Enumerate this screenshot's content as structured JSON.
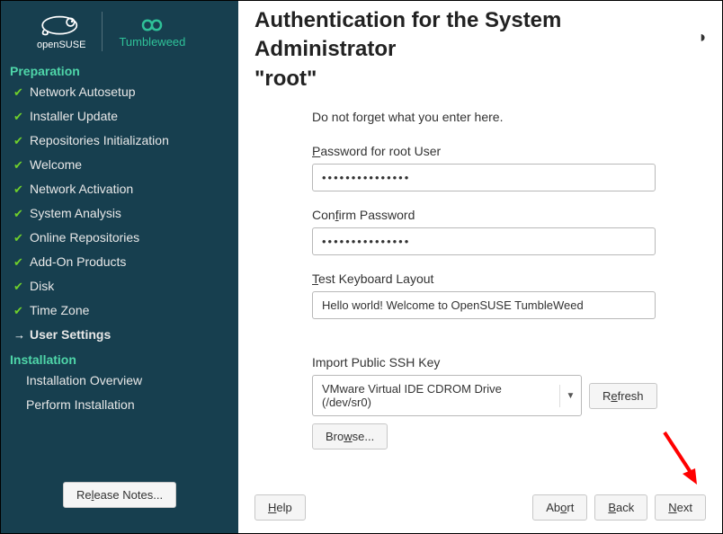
{
  "brand": {
    "name": "openSUSE",
    "edition": "Tumbleweed"
  },
  "sidebar": {
    "sections": [
      {
        "title": "Preparation",
        "items": [
          {
            "label": "Network Autosetup",
            "done": true
          },
          {
            "label": "Installer Update",
            "done": true
          },
          {
            "label": "Repositories Initialization",
            "done": true
          },
          {
            "label": "Welcome",
            "done": true
          },
          {
            "label": "Network Activation",
            "done": true
          },
          {
            "label": "System Analysis",
            "done": true
          },
          {
            "label": "Online Repositories",
            "done": true
          },
          {
            "label": "Add-On Products",
            "done": true
          },
          {
            "label": "Disk",
            "done": true
          },
          {
            "label": "Time Zone",
            "done": true
          },
          {
            "label": "User Settings",
            "current": true
          }
        ]
      },
      {
        "title": "Installation",
        "items": [
          {
            "label": "Installation Overview"
          },
          {
            "label": "Perform Installation"
          }
        ]
      }
    ],
    "release_notes_label": "Release Notes..."
  },
  "page": {
    "title_line1": "Authentication for the System Administrator",
    "title_line2": "\"root\"",
    "hint": "Do not forget what you enter here.",
    "password_label_pre": "P",
    "password_label_rest": "assword for root User",
    "password_value": "●●●●●●●●●●●●●●●",
    "confirm_label_pre": "Con",
    "confirm_label_u": "f",
    "confirm_label_post": "irm Password",
    "confirm_value": "●●●●●●●●●●●●●●●",
    "test_label_pre": "T",
    "test_label_rest": "est Keyboard Layout",
    "test_value": "Hello world! Welcome to OpenSUSE TumbleWeed",
    "ssh_label": "Import Public SSH Key",
    "ssh_device": "VMware Virtual IDE CDROM Drive (/dev/sr0)",
    "refresh_pre": "R",
    "refresh_u": "e",
    "refresh_post": "fresh",
    "browse_pre": "Bro",
    "browse_u": "w",
    "browse_post": "se..."
  },
  "footer": {
    "help_u": "H",
    "help_rest": "elp",
    "abort_pre": "Ab",
    "abort_u": "o",
    "abort_post": "rt",
    "back_u": "B",
    "back_rest": "ack",
    "next_u": "N",
    "next_rest": "ext"
  }
}
